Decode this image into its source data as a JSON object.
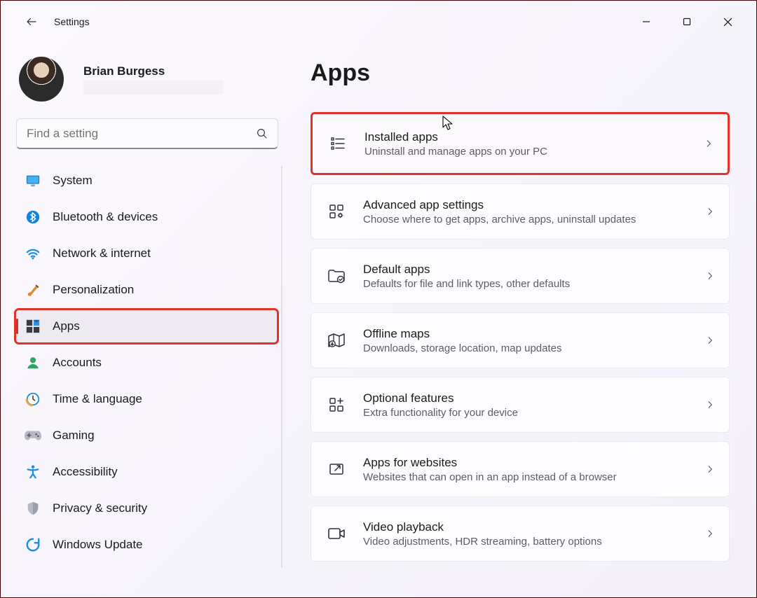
{
  "window": {
    "title": "Settings",
    "back_tooltip": "Back"
  },
  "user": {
    "name": "Brian Burgess"
  },
  "search": {
    "placeholder": "Find a setting"
  },
  "nav": [
    {
      "id": "system",
      "label": "System",
      "icon": "monitor",
      "selected": false
    },
    {
      "id": "bluetooth",
      "label": "Bluetooth & devices",
      "icon": "bluetooth",
      "selected": false
    },
    {
      "id": "network",
      "label": "Network & internet",
      "icon": "wifi",
      "selected": false
    },
    {
      "id": "personalization",
      "label": "Personalization",
      "icon": "brush",
      "selected": false
    },
    {
      "id": "apps",
      "label": "Apps",
      "icon": "apps",
      "selected": true,
      "highlighted": true
    },
    {
      "id": "accounts",
      "label": "Accounts",
      "icon": "person",
      "selected": false
    },
    {
      "id": "time",
      "label": "Time & language",
      "icon": "clock",
      "selected": false
    },
    {
      "id": "gaming",
      "label": "Gaming",
      "icon": "gamepad",
      "selected": false
    },
    {
      "id": "accessibility",
      "label": "Accessibility",
      "icon": "access",
      "selected": false
    },
    {
      "id": "privacy",
      "label": "Privacy & security",
      "icon": "shield",
      "selected": false
    },
    {
      "id": "update",
      "label": "Windows Update",
      "icon": "update",
      "selected": false
    }
  ],
  "page": {
    "title": "Apps"
  },
  "cards": [
    {
      "id": "installed",
      "title": "Installed apps",
      "sub": "Uninstall and manage apps on your PC",
      "icon": "list-check",
      "highlighted": true,
      "cursor": true
    },
    {
      "id": "advanced",
      "title": "Advanced app settings",
      "sub": "Choose where to get apps, archive apps, uninstall updates",
      "icon": "grid-gear"
    },
    {
      "id": "default",
      "title": "Default apps",
      "sub": "Defaults for file and link types, other defaults",
      "icon": "folder-check"
    },
    {
      "id": "offline",
      "title": "Offline maps",
      "sub": "Downloads, storage location, map updates",
      "icon": "map-marker"
    },
    {
      "id": "optional",
      "title": "Optional features",
      "sub": "Extra functionality for your device",
      "icon": "grid-plus"
    },
    {
      "id": "websites",
      "title": "Apps for websites",
      "sub": "Websites that can open in an app instead of a browser",
      "icon": "launch"
    },
    {
      "id": "video",
      "title": "Video playback",
      "sub": "Video adjustments, HDR streaming, battery options",
      "icon": "video"
    }
  ]
}
